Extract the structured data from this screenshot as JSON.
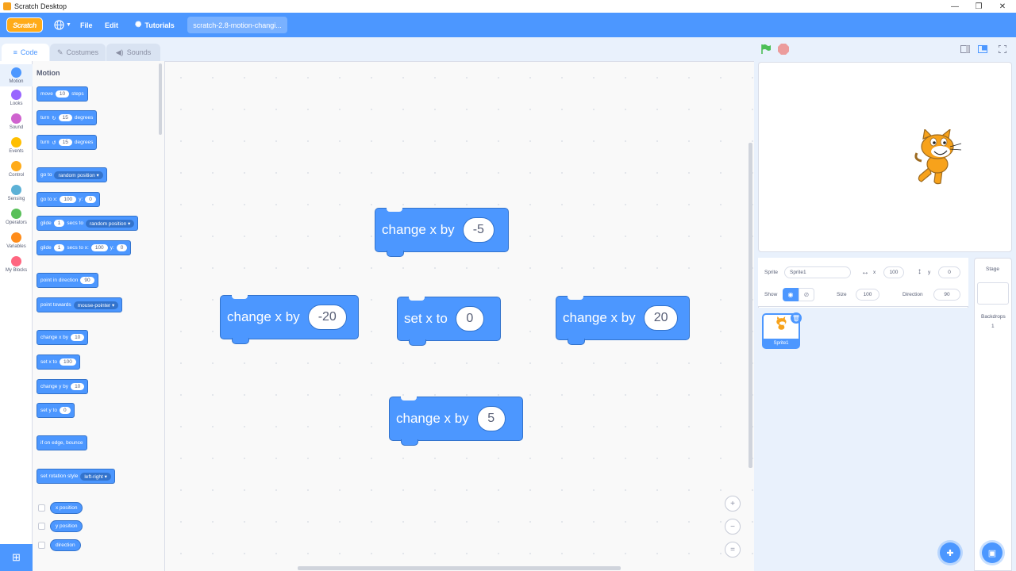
{
  "window": {
    "title": "Scratch Desktop",
    "min": "—",
    "max": "❐",
    "close": "✕"
  },
  "menubar": {
    "logo": "Scratch",
    "file": "File",
    "edit": "Edit",
    "tutorials": "Tutorials",
    "project_title": "scratch-2.8-motion-changi..."
  },
  "tabs": {
    "code": "Code",
    "costumes": "Costumes",
    "sounds": "Sounds"
  },
  "categories": [
    {
      "label": "Motion",
      "color": "#4c97ff"
    },
    {
      "label": "Looks",
      "color": "#9966ff"
    },
    {
      "label": "Sound",
      "color": "#cf63cf"
    },
    {
      "label": "Events",
      "color": "#ffbf00"
    },
    {
      "label": "Control",
      "color": "#ffab19"
    },
    {
      "label": "Sensing",
      "color": "#5cb1d6"
    },
    {
      "label": "Operators",
      "color": "#59c059"
    },
    {
      "label": "Variables",
      "color": "#ff8c1a"
    },
    {
      "label": "My Blocks",
      "color": "#ff6680"
    }
  ],
  "palette": {
    "heading": "Motion",
    "move": {
      "a": "move",
      "v": "10",
      "b": "steps"
    },
    "turn_r": {
      "a": "turn",
      "icon": "↻",
      "v": "15",
      "b": "degrees"
    },
    "turn_l": {
      "a": "turn",
      "icon": "↺",
      "v": "15",
      "b": "degrees"
    },
    "goto": {
      "a": "go to",
      "dd": "random position ▾"
    },
    "gotoxy": {
      "a": "go to x:",
      "x": "100",
      "b": "y:",
      "y": "0"
    },
    "glide": {
      "a": "glide",
      "v": "1",
      "b": "secs to",
      "dd": "random position ▾"
    },
    "glidexy": {
      "a": "glide",
      "v": "1",
      "b": "secs to x:",
      "x": "100",
      "c": "y:",
      "y": "0"
    },
    "pointdir": {
      "a": "point in direction",
      "v": "90"
    },
    "pointto": {
      "a": "point towards",
      "dd": "mouse-pointer ▾"
    },
    "changex": {
      "a": "change x by",
      "v": "10"
    },
    "setx": {
      "a": "set x to",
      "v": "100"
    },
    "changey": {
      "a": "change y by",
      "v": "10"
    },
    "sety": {
      "a": "set y to",
      "v": "0"
    },
    "bounce": {
      "a": "if on edge, bounce"
    },
    "rotstyle": {
      "a": "set rotation style",
      "dd": "left-right ▾"
    },
    "xpos": "x position",
    "ypos": "y position",
    "direction": "direction"
  },
  "script_blocks": [
    {
      "label": "change x by",
      "value": "-5"
    },
    {
      "label": "change x by",
      "value": "-20"
    },
    {
      "label": "set x to",
      "value": "0"
    },
    {
      "label": "change x by",
      "value": "20"
    },
    {
      "label": "change x by",
      "value": "5"
    }
  ],
  "zoom": {
    "in": "+",
    "out": "−",
    "reset": "="
  },
  "sprite_info": {
    "sprite_label": "Sprite",
    "sprite_name": "Sprite1",
    "x_label": "x",
    "x": "100",
    "y_label": "y",
    "y": "0",
    "show_label": "Show",
    "size_label": "Size",
    "size": "100",
    "direction_label": "Direction",
    "direction": "90"
  },
  "sprites": [
    {
      "name": "Sprite1"
    }
  ],
  "stage_panel": {
    "title": "Stage",
    "backdrops_label": "Backdrops",
    "backdrops_count": "1"
  }
}
